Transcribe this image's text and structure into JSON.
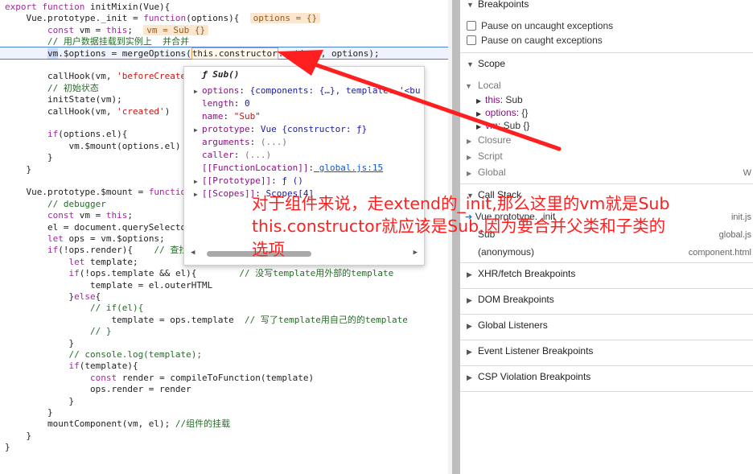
{
  "editor": {
    "lines": [
      {
        "segments": [
          {
            "t": "export ",
            "c": "kw"
          },
          {
            "t": "function ",
            "c": "kw"
          },
          {
            "t": "initMixin(Vue){",
            "c": "fn"
          }
        ]
      },
      {
        "segments": [
          {
            "t": "    Vue.prototype._init = ",
            "c": "fn"
          },
          {
            "t": "function",
            "c": "kw"
          },
          {
            "t": "(options){  ",
            "c": "fn"
          },
          {
            "t": "options = {}",
            "c": "inline-val"
          }
        ]
      },
      {
        "segments": [
          {
            "t": "        ",
            "c": "fn"
          },
          {
            "t": "const ",
            "c": "kw"
          },
          {
            "t": "vm = ",
            "c": "fn"
          },
          {
            "t": "this",
            "c": "kw"
          },
          {
            "t": ";  ",
            "c": "fn"
          },
          {
            "t": "vm = Sub {}",
            "c": "inline-val"
          }
        ]
      },
      {
        "segments": [
          {
            "t": "        // 用户数据挂载到实例上  并合并",
            "c": "cmt"
          }
        ]
      },
      {
        "segments": [
          {
            "t": "        ",
            "c": "fn"
          },
          {
            "t": "vm",
            "c": "vm-mark"
          },
          {
            "t": ".$options = mergeOptions(",
            "c": "fn"
          },
          {
            "t": "this.constructor",
            "c": "ctor-box"
          },
          {
            "t": ".options, options);",
            "c": "fn"
          }
        ]
      },
      {
        "segments": []
      },
      {
        "segments": [
          {
            "t": "        callHook(vm, ",
            "c": "fn"
          },
          {
            "t": "'beforeCreate'",
            "c": "str"
          }
        ]
      },
      {
        "segments": [
          {
            "t": "        // 初始状态",
            "c": "cmt"
          }
        ]
      },
      {
        "segments": [
          {
            "t": "        initState(vm);",
            "c": "fn"
          }
        ]
      },
      {
        "segments": [
          {
            "t": "        callHook(vm, ",
            "c": "fn"
          },
          {
            "t": "'created'",
            "c": "str"
          },
          {
            "t": ")",
            "c": "fn"
          }
        ]
      },
      {
        "segments": []
      },
      {
        "segments": [
          {
            "t": "        ",
            "c": "fn"
          },
          {
            "t": "if",
            "c": "kw"
          },
          {
            "t": "(options.el){",
            "c": "fn"
          }
        ]
      },
      {
        "segments": [
          {
            "t": "            vm.$mount(options.el)",
            "c": "fn"
          }
        ]
      },
      {
        "segments": [
          {
            "t": "        }",
            "c": "fn"
          }
        ]
      },
      {
        "segments": [
          {
            "t": "    }",
            "c": "fn"
          }
        ]
      },
      {
        "segments": []
      },
      {
        "segments": [
          {
            "t": "    Vue.prototype.$mount = ",
            "c": "fn"
          },
          {
            "t": "functio",
            "c": "kw"
          }
        ]
      },
      {
        "segments": [
          {
            "t": "        // debugger",
            "c": "cmt"
          }
        ]
      },
      {
        "segments": [
          {
            "t": "        ",
            "c": "fn"
          },
          {
            "t": "const ",
            "c": "kw"
          },
          {
            "t": "vm = ",
            "c": "fn"
          },
          {
            "t": "this",
            "c": "kw"
          },
          {
            "t": ";",
            "c": "fn"
          }
        ]
      },
      {
        "segments": [
          {
            "t": "        el = document.querySelecto",
            "c": "fn"
          }
        ]
      },
      {
        "segments": [
          {
            "t": "        ",
            "c": "fn"
          },
          {
            "t": "let ",
            "c": "kw"
          },
          {
            "t": "ops = vm.$options;",
            "c": "fn"
          }
        ]
      },
      {
        "segments": [
          {
            "t": "        ",
            "c": "fn"
          },
          {
            "t": "if",
            "c": "kw"
          },
          {
            "t": "(!ops.render){    ",
            "c": "fn"
          },
          {
            "t": "// 查找",
            "c": "cmt"
          }
        ]
      },
      {
        "segments": [
          {
            "t": "            ",
            "c": "fn"
          },
          {
            "t": "let ",
            "c": "kw"
          },
          {
            "t": "template;",
            "c": "fn"
          }
        ]
      },
      {
        "segments": [
          {
            "t": "            ",
            "c": "fn"
          },
          {
            "t": "if",
            "c": "kw"
          },
          {
            "t": "(!ops.template && el){        ",
            "c": "fn"
          },
          {
            "t": "// 没写template用外部的template",
            "c": "cmt"
          }
        ]
      },
      {
        "segments": [
          {
            "t": "                template = el.outerHTML",
            "c": "fn"
          }
        ]
      },
      {
        "segments": [
          {
            "t": "            }",
            "c": "fn"
          },
          {
            "t": "else",
            "c": "kw"
          },
          {
            "t": "{",
            "c": "fn"
          }
        ]
      },
      {
        "segments": [
          {
            "t": "                // if(el){",
            "c": "cmt"
          }
        ]
      },
      {
        "segments": [
          {
            "t": "                    template = ops.template  ",
            "c": "fn"
          },
          {
            "t": "// 写了template用自己的的template",
            "c": "cmt"
          }
        ]
      },
      {
        "segments": [
          {
            "t": "                // }",
            "c": "cmt"
          }
        ]
      },
      {
        "segments": [
          {
            "t": "            }",
            "c": "fn"
          }
        ]
      },
      {
        "segments": [
          {
            "t": "            // console.log(template);",
            "c": "cmt"
          }
        ]
      },
      {
        "segments": [
          {
            "t": "            ",
            "c": "fn"
          },
          {
            "t": "if",
            "c": "kw"
          },
          {
            "t": "(template){",
            "c": "fn"
          }
        ]
      },
      {
        "segments": [
          {
            "t": "                ",
            "c": "fn"
          },
          {
            "t": "const ",
            "c": "kw"
          },
          {
            "t": "render = compileToFunction(template)",
            "c": "fn"
          }
        ]
      },
      {
        "segments": [
          {
            "t": "                ops.render = render",
            "c": "fn"
          }
        ]
      },
      {
        "segments": [
          {
            "t": "            }",
            "c": "fn"
          }
        ]
      },
      {
        "segments": [
          {
            "t": "        }",
            "c": "fn"
          }
        ]
      },
      {
        "segments": [
          {
            "t": "        mountComponent(vm, el); ",
            "c": "fn"
          },
          {
            "t": "//组件的挂载",
            "c": "cmt"
          }
        ]
      },
      {
        "segments": [
          {
            "t": "    }",
            "c": "fn"
          }
        ]
      },
      {
        "segments": [
          {
            "t": "}",
            "c": "fn"
          }
        ]
      }
    ]
  },
  "popover": {
    "title": "ƒ Sub()",
    "rows": [
      {
        "expand": true,
        "key": "options",
        "value": " {components: {…}, template: '<bu",
        "vc": "pv"
      },
      {
        "expand": false,
        "key": "length",
        "value": " 0",
        "vc": "pv"
      },
      {
        "expand": false,
        "key": "name",
        "value": " \"Sub\"",
        "vc": "ps"
      },
      {
        "expand": true,
        "key": "prototype",
        "value": " Vue {constructor: ƒ}",
        "vc": "pv"
      },
      {
        "expand": false,
        "key": "arguments",
        "value": " (...)",
        "vc": "pg"
      },
      {
        "expand": false,
        "key": "caller",
        "value": " (...)",
        "vc": "pg"
      },
      {
        "expand": false,
        "key": "[[FunctionLocation]]",
        "value": " global.js:15",
        "vc": "plink"
      },
      {
        "expand": true,
        "key": "[[Prototype]]",
        "value": " ƒ ()",
        "vc": "pv"
      },
      {
        "expand": true,
        "key": "[[Scopes]]",
        "value": " Scopes[4]",
        "vc": "pv"
      }
    ]
  },
  "sidebar": {
    "breakpoints": {
      "label": "Breakpoints"
    },
    "pause_uncaught": "Pause on uncaught exceptions",
    "pause_caught": "Pause on caught exceptions",
    "scope": {
      "label": "Scope"
    },
    "local": "Local",
    "this_key": "this",
    "this_val": " Sub",
    "options_key": "options",
    "options_val": " {}",
    "vm_key": "vm",
    "vm_val": " Sub {}",
    "closure": "Closure",
    "script": "Script",
    "global": "Global",
    "global_right": "W",
    "call_stack": "Call Stack",
    "frames": [
      {
        "name": "Vue.prototype._init",
        "file": "init.js"
      },
      {
        "name": "Sub",
        "file": "global.js"
      },
      {
        "name": "(anonymous)",
        "file": "component.html"
      }
    ],
    "xhr": "XHR/fetch Breakpoints",
    "dom": "DOM Breakpoints",
    "global_listeners": "Global Listeners",
    "event_listener": "Event Listener Breakpoints",
    "csp": "CSP Violation Breakpoints"
  },
  "annotation": {
    "line1": "对于组件来说，走extend的_init,那么这里的vm就是Sub",
    "line2": "this.constructor就应该是Sub,因为要合并父类和子类的",
    "line3": "选项",
    "color": "#ff1f1f"
  }
}
